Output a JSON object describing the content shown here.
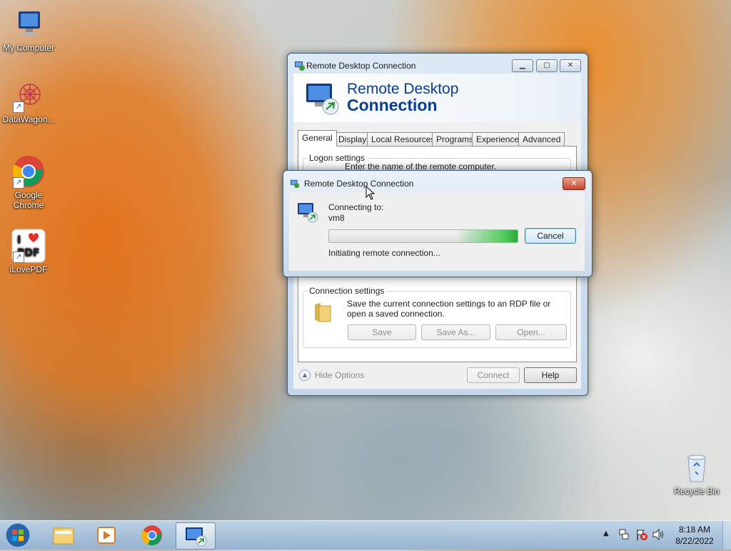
{
  "desktop": {
    "icons": [
      {
        "label": "My Computer"
      },
      {
        "label": "DataWagon..."
      },
      {
        "label": "Google Chrome"
      },
      {
        "label": "iLovePDF"
      },
      {
        "label": "Recycle Bin"
      }
    ]
  },
  "rdc_window": {
    "title": "Remote Desktop Connection",
    "banner_line1": "Remote Desktop",
    "banner_line2": "Connection",
    "tabs": [
      "General",
      "Display",
      "Local Resources",
      "Programs",
      "Experience",
      "Advanced"
    ],
    "active_tab": "General",
    "logon_group_label": "Logon settings",
    "logon_hint": "Enter the name of the remote computer.",
    "conn_group_label": "Connection settings",
    "conn_text": "Save the current connection settings to an RDP file or open a saved connection.",
    "save_label": "Save",
    "save_as_label": "Save As...",
    "open_label": "Open...",
    "hide_options_label": "Hide Options",
    "connect_label": "Connect",
    "help_label": "Help"
  },
  "connecting_dialog": {
    "title": "Remote Desktop Connection",
    "connecting_to_label": "Connecting to:",
    "target": "vm8",
    "status": "Initiating remote connection...",
    "progress": 0.33,
    "cancel_label": "Cancel"
  },
  "taskbar": {
    "items": [
      "start-orb",
      "windows-explorer",
      "media-player",
      "google-chrome",
      "remote-desktop-connection"
    ],
    "time": "8:18 AM",
    "date": "8/22/2022"
  }
}
